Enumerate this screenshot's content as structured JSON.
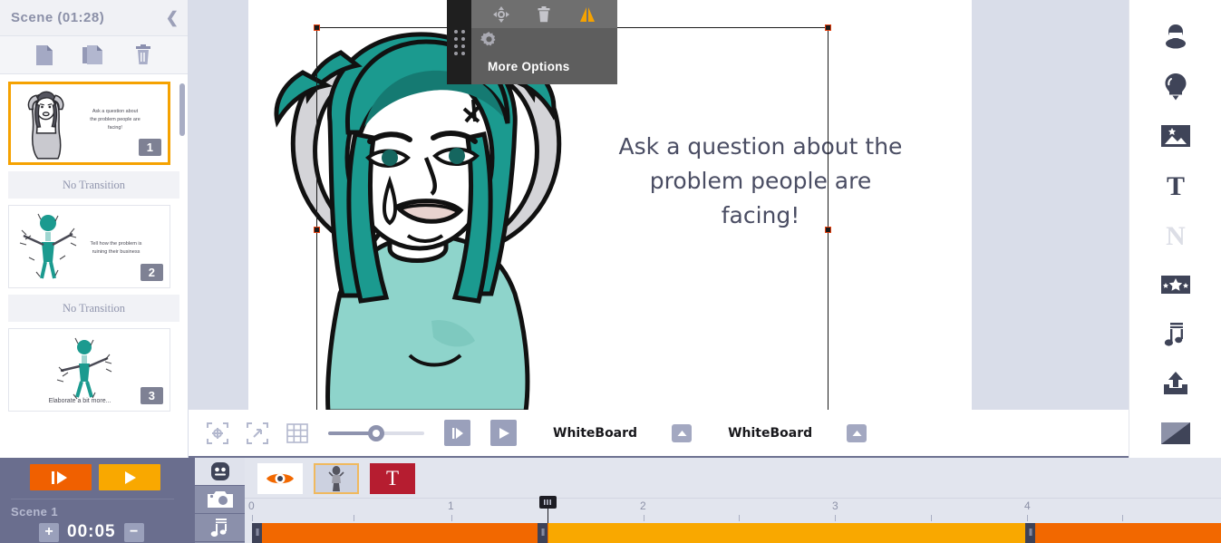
{
  "sidebar": {
    "title": "Scene  (01:28)",
    "collapse_icon": "chevron-left-icon",
    "tools": [
      {
        "name": "new-page-icon",
        "label": "New Page"
      },
      {
        "name": "duplicate-page-icon",
        "label": "Duplicate Page"
      },
      {
        "name": "delete-page-icon",
        "label": "Delete Page"
      }
    ],
    "scenes": [
      {
        "number": "1",
        "caption": "Ask a question about the problem people are facing!",
        "selected": true
      },
      {
        "number": "2",
        "caption": "Tell how the problem is ruining their business",
        "selected": false
      },
      {
        "number": "3",
        "caption": "Elaborate a bit more...",
        "selected": false
      }
    ],
    "transitions": [
      "No Transition",
      "No Transition"
    ]
  },
  "object_toolbar": {
    "move_icon": "move-icon",
    "delete_icon": "trash-icon",
    "flip_icon": "flip-icon",
    "settings_icon": "gear-icon",
    "more_options_label": "More Options",
    "drag_handle_icon": "drag-grip-icon"
  },
  "canvas": {
    "text": "Ask a question about the problem people are facing!",
    "character_alt": "frustrated-woman-teal-hair"
  },
  "canvas_controls": {
    "center_icon": "center-object-icon",
    "fit_icon": "fit-to-screen-icon",
    "grid_icon": "grid-icon",
    "zoom_value": "50",
    "step_play_icon": "step-play-icon",
    "play_icon": "play-icon",
    "background_label": "WhiteBoard",
    "background_chevron": "chevron-up-icon",
    "hand_style_label": "WhiteBoard",
    "hand_style_chevron": "chevron-up-icon"
  },
  "right_sidebar": {
    "items": [
      {
        "name": "character-icon",
        "label": "Characters"
      },
      {
        "name": "lightbulb-icon",
        "label": "Props"
      },
      {
        "name": "image-icon",
        "label": "Images"
      },
      {
        "name": "text-icon",
        "label": "Text"
      },
      {
        "name": "letter-n-icon",
        "label": "Shapes"
      },
      {
        "name": "effects-icon",
        "label": "Effects"
      },
      {
        "name": "music-icon",
        "label": "Music"
      },
      {
        "name": "upload-icon",
        "label": "Upload"
      },
      {
        "name": "background-icon",
        "label": "Background"
      }
    ]
  },
  "timeline": {
    "play_all_icon": "play-all-icon",
    "play_scene_icon": "play-scene-icon",
    "scene_label": "Scene 1",
    "time_value": "00:05",
    "increase_label": "+",
    "decrease_label": "−",
    "track_rail": [
      {
        "name": "character-track-icon",
        "active": true
      },
      {
        "name": "camera-track-icon",
        "active": false
      },
      {
        "name": "music-track-icon",
        "active": false
      }
    ],
    "elements": [
      {
        "name": "visibility-toggle",
        "icon": "eye-icon",
        "selected": false
      },
      {
        "name": "character-element",
        "icon": "character-thumb-icon",
        "selected": true
      },
      {
        "name": "text-element",
        "label": "T",
        "selected": false
      }
    ],
    "ruler_labels": [
      "0",
      "1",
      "2",
      "3",
      "4"
    ],
    "playhead_position": "1.55",
    "clips": [
      {
        "color": "#f26800",
        "start_pct": 0,
        "width_pct": 30.0
      },
      {
        "color": "#f9a800",
        "start_pct": 30.0,
        "width_pct": 50.0
      },
      {
        "color": "#f26800",
        "start_pct": 80.0,
        "width_pct": 20.0
      }
    ]
  },
  "colors": {
    "accent_orange": "#f5a201",
    "panel_blue": "#6a6e8e",
    "clip_orange": "#f26800",
    "clip_amber": "#f9a800",
    "text_dark": "#4a4d63",
    "teal": "#1b9a8f"
  }
}
